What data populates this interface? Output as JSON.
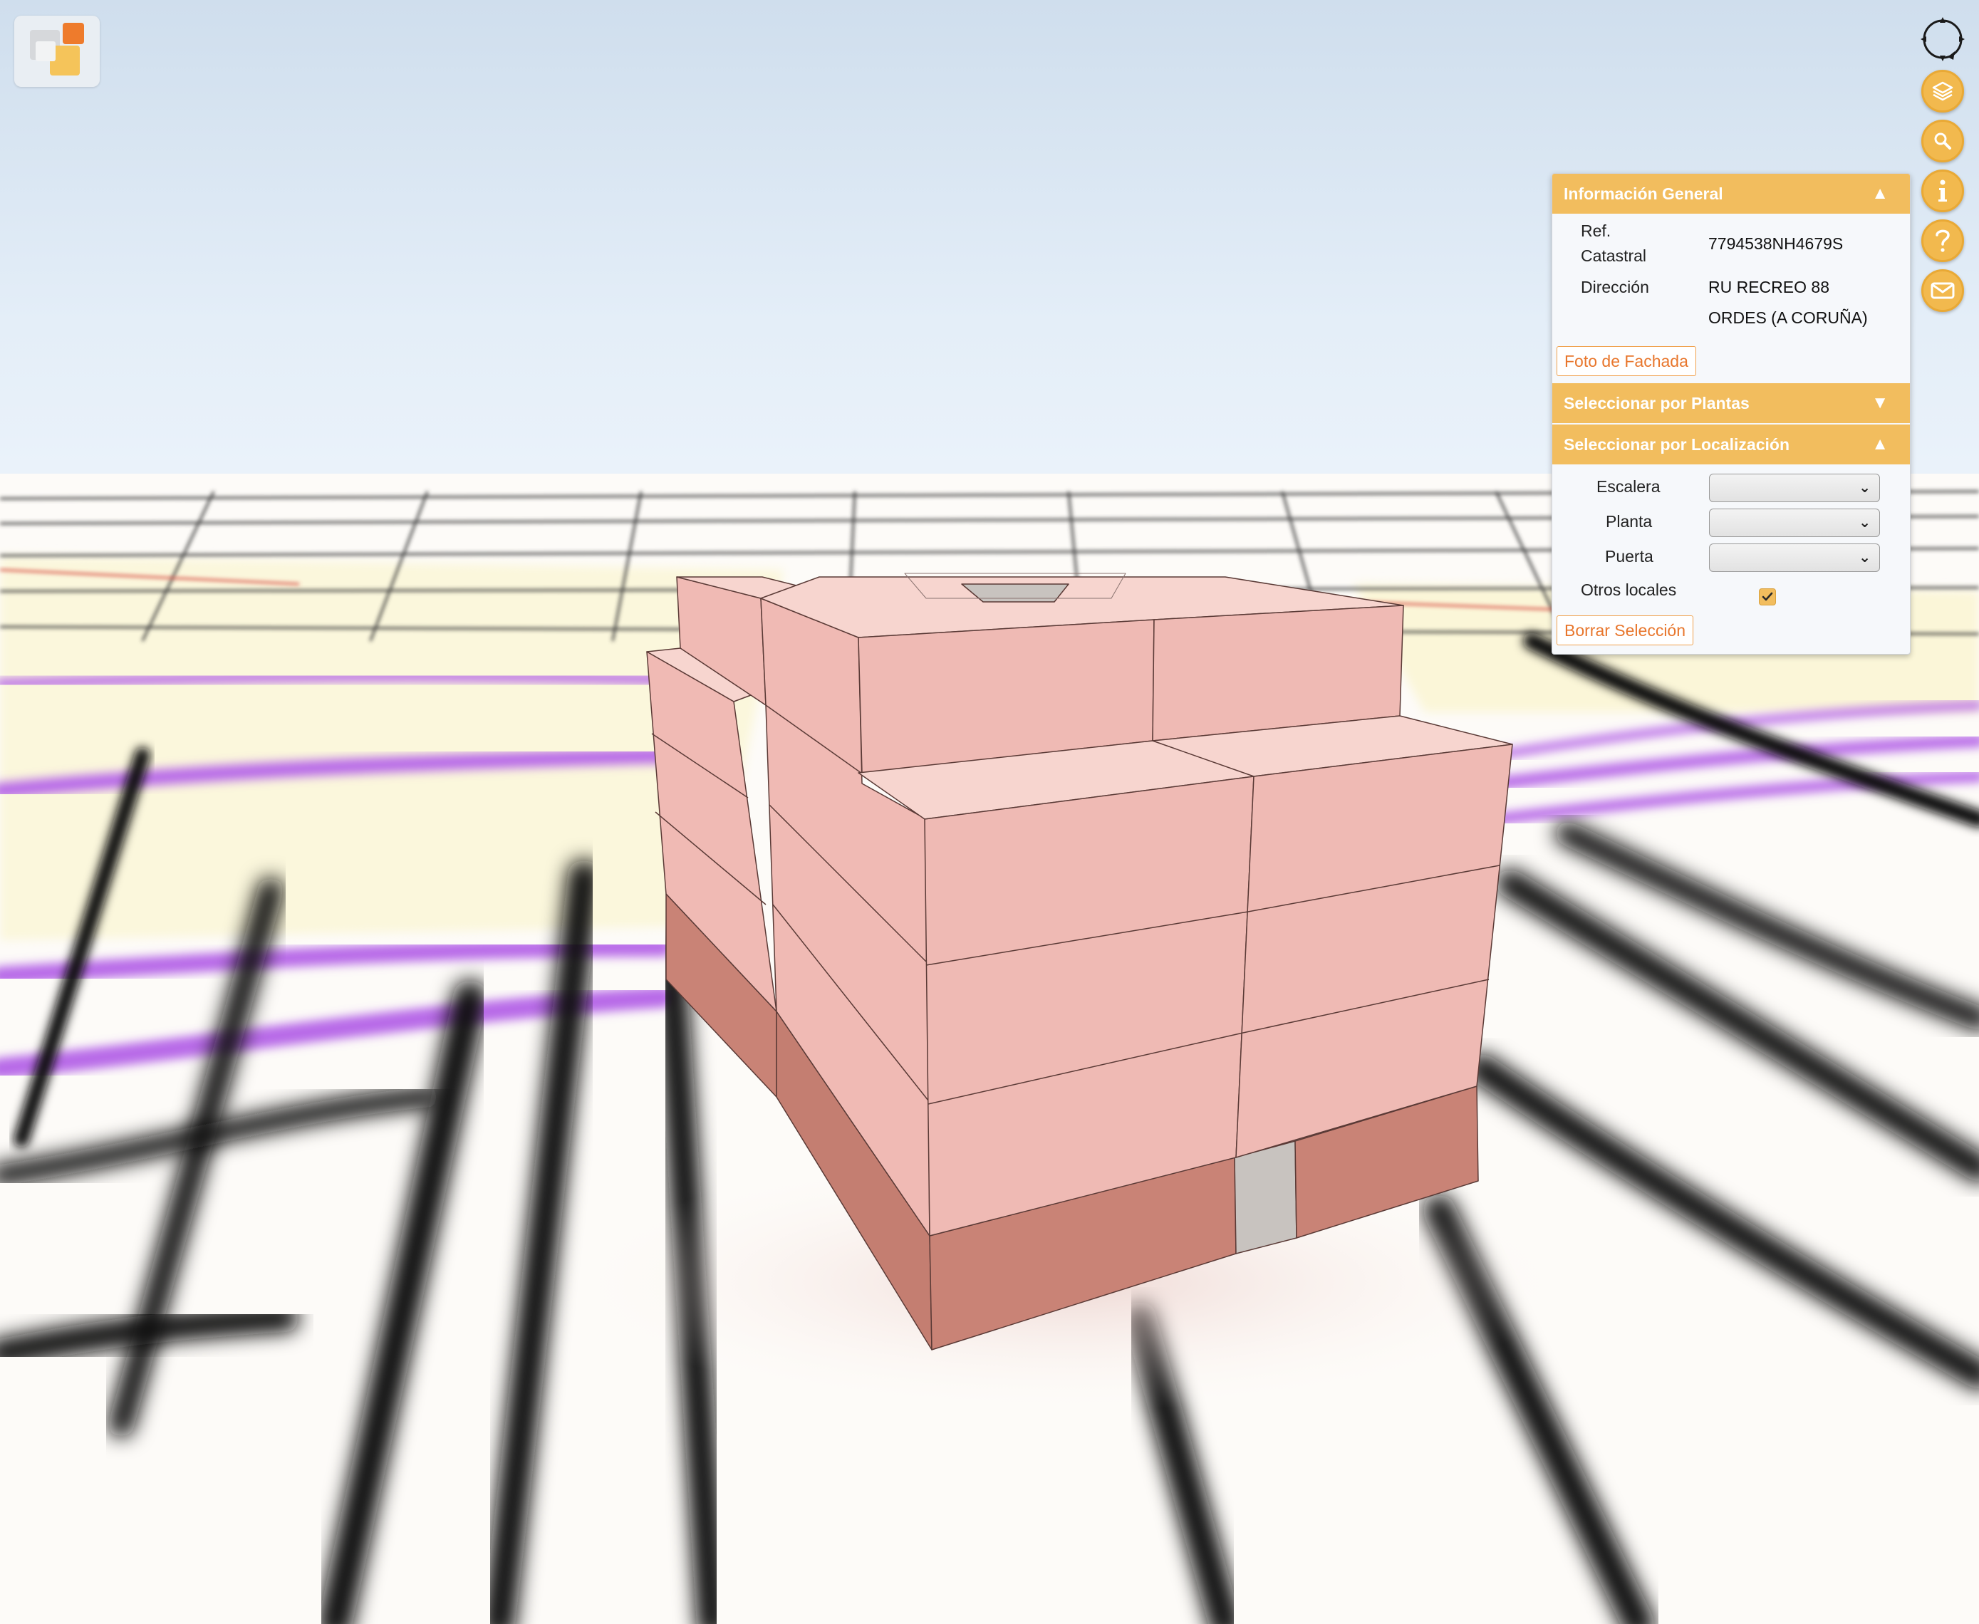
{
  "panel": {
    "general": {
      "title": "Información General",
      "arrow": "▲",
      "ref_label_line1": "Ref.",
      "ref_label_line2": "Catastral",
      "ref_value": "7794538NH4679S",
      "address_label": "Dirección",
      "address_line1": "RU RECREO 88",
      "address_line2": "ORDES (A CORUÑA)",
      "facade_button": "Foto de Fachada"
    },
    "plantas": {
      "title": "Seleccionar por Plantas",
      "arrow": "▼"
    },
    "localizacion": {
      "title": "Seleccionar por Localización",
      "arrow": "▲",
      "escalera_label": "Escalera",
      "planta_label": "Planta",
      "puerta_label": "Puerta",
      "otros_label": "Otros locales",
      "otros_checked": true,
      "clear_button": "Borrar Selección"
    }
  },
  "toolbar": {
    "icons": [
      "compass-icon",
      "layers-icon",
      "search-icon",
      "info-icon",
      "help-icon",
      "mail-icon"
    ],
    "accent_color": "#f2b94e"
  },
  "colors": {
    "building_upper": "#f0bab4",
    "building_top": "#f7d5cf",
    "building_ground": "#c98376",
    "purple_lines": "#b86ae8",
    "panel_header": "#f2bd5e"
  }
}
